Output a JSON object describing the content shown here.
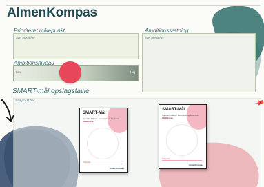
{
  "app": {
    "logo_text_a": "AlmenK",
    "logo_text_o": "o",
    "logo_text_b": "mpas"
  },
  "sections": {
    "prioriteret": {
      "label": "Prioriteret målepunkt",
      "hint": "Sæt postit her"
    },
    "ambition": {
      "label": "Ambitionssætning",
      "hint": "Sæt postit her"
    },
    "niveau": {
      "label": "Ambitionsniveau",
      "low": "Lav",
      "high": "Høj",
      "level": 0.45
    },
    "smart": {
      "label": "SMART-mål opslagstavle",
      "hint": "Sæt postit her"
    }
  },
  "cards": [
    {
      "title": "SMART-Mål",
      "subtitle": "Specifikt, Målbart, Accepteret og Realistisk, Tidsbestemt",
      "line": "SMART - mål",
      "footer": "Tidspunkt",
      "brand": "AlmenKompas"
    },
    {
      "title": "SMART-Mål",
      "subtitle": "Specifikt, Målbart, Accepteret og Realistisk, Tidsbestemt",
      "line": "SMART - mål",
      "footer": "Tidspunkt",
      "brand": "AlmenKompas"
    }
  ],
  "colors": {
    "accent": "#e8475a",
    "brand": "#1f4a55",
    "teal_blob": "#2f6e6a",
    "navy_blob": "#1f3a5c",
    "pink_blob": "#e8475a"
  },
  "icons": {
    "pin": "pushpin-icon",
    "arrow": "hand-drawn-arrow-icon"
  }
}
